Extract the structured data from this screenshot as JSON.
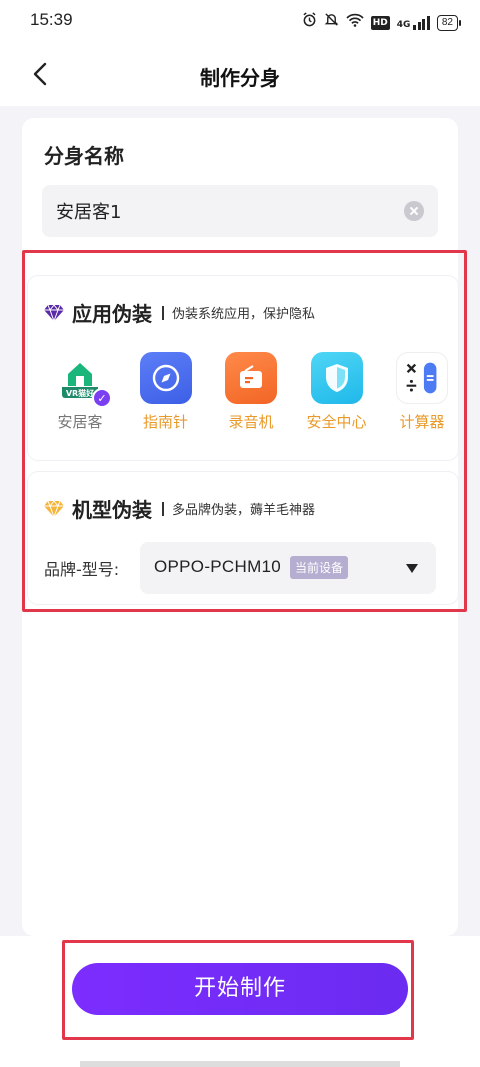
{
  "status_bar": {
    "time": "15:39",
    "network": "4G",
    "hd": "HD",
    "battery": "82"
  },
  "nav": {
    "title": "制作分身"
  },
  "name_section": {
    "title": "分身名称",
    "value": "安居客1"
  },
  "app_disguise": {
    "title": "应用伪装",
    "subtitle": "伪装系统应用，保护隐私",
    "apps": [
      {
        "label": "安居客",
        "icon": "house-icon",
        "selected": true,
        "badge_text": "VR猫好"
      },
      {
        "label": "指南针",
        "icon": "compass-icon",
        "selected": false
      },
      {
        "label": "录音机",
        "icon": "recorder-icon",
        "selected": false
      },
      {
        "label": "安全中心",
        "icon": "shield-icon",
        "selected": false
      },
      {
        "label": "计算器",
        "icon": "calculator-icon",
        "selected": false
      }
    ]
  },
  "model_disguise": {
    "title": "机型伪装",
    "subtitle": "多品牌伪装，薅羊毛神器",
    "brand_label": "品牌-型号:",
    "brand_value": "OPPO-PCHM10",
    "current_tag": "当前设备"
  },
  "action": {
    "start_label": "开始制作"
  },
  "colors": {
    "accent": "#7b3ff2",
    "app_label": "#e99a2a",
    "highlight": "#e2364a"
  }
}
